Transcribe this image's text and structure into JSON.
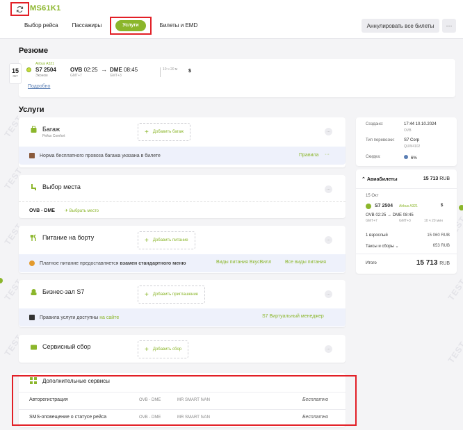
{
  "header": {
    "pnr": "MS61K1",
    "tabs": [
      "Выбор рейса",
      "Пассажиры",
      "Услуги",
      "Билеты и EMD"
    ],
    "active_tab": "Услуги",
    "cancel_all_label": "Аннулировать все билеты",
    "more_label": "···"
  },
  "watermark": "TEST",
  "summary": {
    "title": "Резюме",
    "flight": {
      "date_day": "15",
      "date_month": "окт",
      "aircraft": "Airbus A321",
      "number": "S7  2504",
      "class": "Эконом",
      "dep_code": "OVB",
      "dep_time": "02:25",
      "dep_gmt": "GMT+7",
      "arr_code": "DME",
      "arr_time": "08:45",
      "arr_gmt": "GMT+3",
      "duration": "10 ч 20 м",
      "currency_icon": "$",
      "details": "Подробно"
    }
  },
  "services": {
    "title": "Услуги",
    "baggage": {
      "name": "Багаж",
      "sub": "Рейск Comfort",
      "add": "Добавить багаж",
      "note": "Норма бесплатного провоза багажа указана в билете",
      "note_link": "Правила"
    },
    "seat": {
      "name": "Выбор места",
      "route": "OVB - DME",
      "choose": "Выбрать место"
    },
    "meal": {
      "name": "Питание на борту",
      "add": "Добавить питание",
      "note_pre": "Платное питание предоставляется ",
      "note_bold": "взамен стандартного меню",
      "link1": "Виды питания ВкусВилл",
      "link2": "Все виды питания"
    },
    "lounge": {
      "name": "Бизнес-зал S7",
      "add": "Добавить приглашение",
      "note_pre": "Правила услуги доступны ",
      "note_link": "на сайте",
      "link_right": "S7 Виртуальный менеджер"
    },
    "fee": {
      "name": "Сервисный сбор",
      "add": "Добавить сбор"
    },
    "additional": {
      "name": "Дополнительные сервисы",
      "rows": [
        {
          "name": "Авторегистрация",
          "route": "OVB - DME",
          "pax": "MR SMART IVAN",
          "price": "Бесплатно"
        },
        {
          "name": "SMS-оповещение о статусе рейса",
          "route": "OVB - DME",
          "pax": "MR SMART IVAN",
          "price": "Бесплатно"
        }
      ]
    }
  },
  "side": {
    "created_label": "Создано:",
    "created_value": "17:44 10.10.2024",
    "created_sub": "OVB",
    "carrier_type_label": "Тип перевозки:",
    "carrier_type_value": "S7 Corp",
    "carrier_type_sub": "QUW4102",
    "discount_label": "Скидка:",
    "discount_value": "6%",
    "tickets_title": "Авиабилеты",
    "tickets_total": "15 713",
    "currency": "RUB",
    "flight_date": "15 Окт",
    "flight_number": "S7 2504",
    "flight_aircraft": "Airbus A321",
    "flight_dollar": "$",
    "route_text": "OVB 02:25 → DME 08:45",
    "gmt_dep": "GMT+7",
    "gmt_arr": "GMT+3",
    "duration": "10 ч 20 мин",
    "adult_label": "1 взрослый",
    "adult_value": "15 060 RUB",
    "taxes_label": "Таксы и сборы",
    "taxes_value": "653 RUB",
    "total_label": "Итого",
    "total_value": "15 713",
    "total_currency": "RUB"
  },
  "colors": {
    "accent": "#8bb62b",
    "highlight": "#e21f26",
    "note_bg": "#eef1fb"
  }
}
